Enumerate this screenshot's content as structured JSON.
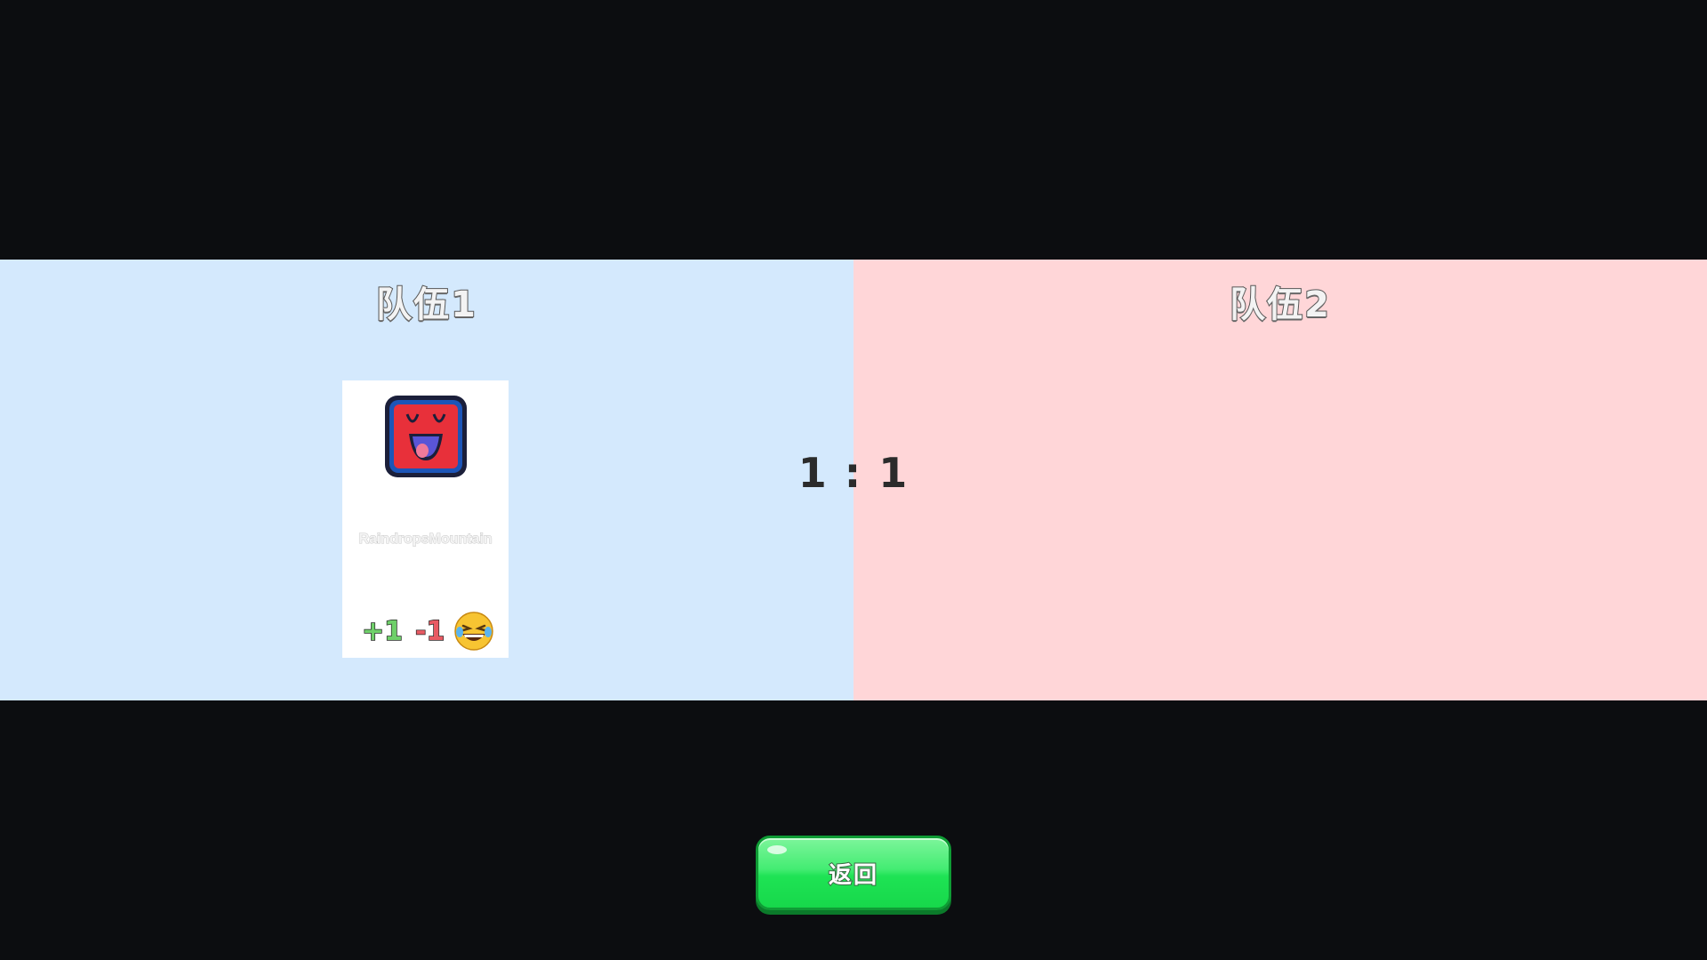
{
  "teams": [
    {
      "title": "队伍1",
      "color": "#d4e9fd",
      "players": [
        {
          "name": "RaindropsMountain",
          "avatar_icon": "red-square-laughing-face-icon",
          "plus_label": "+1",
          "minus_label": "-1",
          "emoji_icon": "laughing-tears-emoji-icon"
        }
      ]
    },
    {
      "title": "队伍2",
      "color": "#ffd6d8",
      "players": []
    }
  ],
  "score": "1 : 1",
  "return_button": {
    "label": "返回",
    "color": "#1ee354"
  },
  "background_color": "#0c0d10"
}
